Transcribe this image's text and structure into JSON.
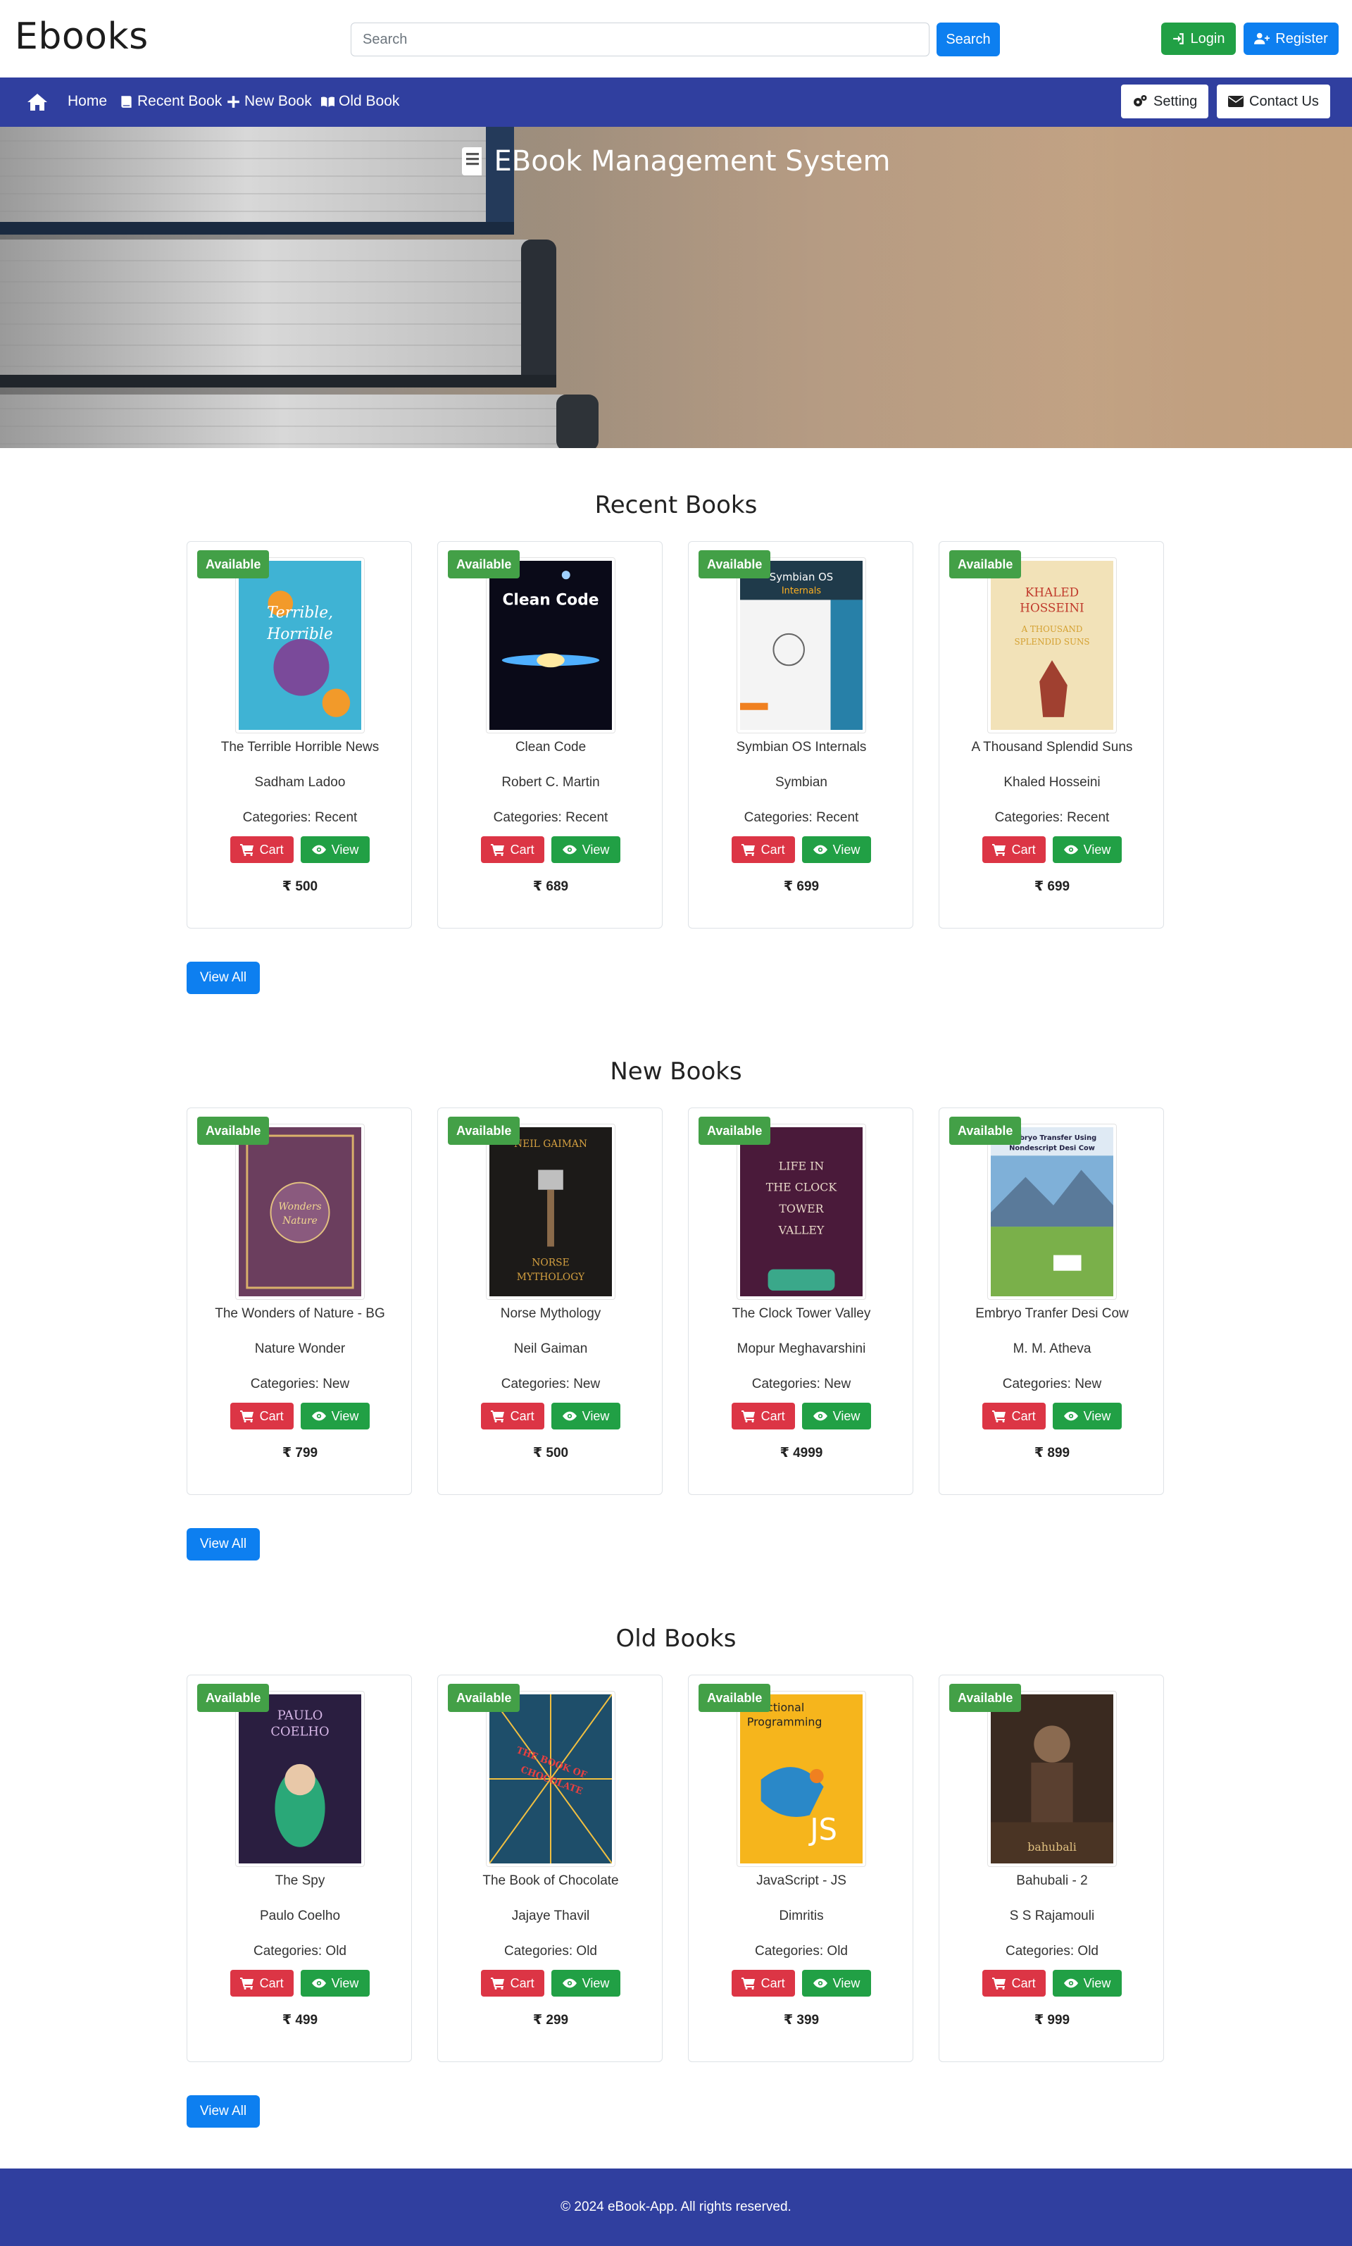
{
  "header": {
    "brand": "Ebooks",
    "search_placeholder": "Search",
    "search_button": "Search",
    "login_button": "Login",
    "register_button": "Register"
  },
  "nav": {
    "home": "Home",
    "recent_book": "Recent Book",
    "new_book": "New Book",
    "old_book": "Old Book",
    "setting": "Setting",
    "contact_us": "Contact Us"
  },
  "hero": {
    "title": "EBook Management System"
  },
  "sections": [
    {
      "title": "Recent Books",
      "view_all": "View All",
      "books": [
        {
          "badge": "Available",
          "title": "The Terrible Horrible News",
          "author": "Sadham Ladoo",
          "category": "Categories: Recent",
          "cart": "Cart",
          "view": "View",
          "price": "₹ 500",
          "cover_color": "#3fb3d4"
        },
        {
          "badge": "Available",
          "title": "Clean Code",
          "author": "Robert C. Martin",
          "category": "Categories: Recent",
          "cart": "Cart",
          "view": "View",
          "price": "₹ 689",
          "cover_color": "#0a0a18"
        },
        {
          "badge": "Available",
          "title": "Symbian OS Internals",
          "author": "Symbian",
          "category": "Categories: Recent",
          "cart": "Cart",
          "view": "View",
          "price": "₹ 699",
          "cover_color": "#1f3a4a"
        },
        {
          "badge": "Available",
          "title": "A Thousand Splendid Suns",
          "author": "Khaled Hosseini",
          "category": "Categories: Recent",
          "cart": "Cart",
          "view": "View",
          "price": "₹ 699",
          "cover_color": "#f2e2b8"
        }
      ]
    },
    {
      "title": "New Books",
      "view_all": "View All",
      "books": [
        {
          "badge": "Available",
          "title": "The Wonders of Nature - BG",
          "author": "Nature Wonder",
          "category": "Categories: New",
          "cart": "Cart",
          "view": "View",
          "price": "₹ 799",
          "cover_color": "#6b3e5e"
        },
        {
          "badge": "Available",
          "title": "Norse Mythology",
          "author": "Neil Gaiman",
          "category": "Categories: New",
          "cart": "Cart",
          "view": "View",
          "price": "₹ 500",
          "cover_color": "#1c1a18"
        },
        {
          "badge": "Available",
          "title": "The Clock Tower Valley",
          "author": "Mopur Meghavarshini",
          "category": "Categories: New",
          "cart": "Cart",
          "view": "View",
          "price": "₹ 4999",
          "cover_color": "#4a1a3a"
        },
        {
          "badge": "Available",
          "title": "Embryo Tranfer Desi Cow",
          "author": "M. M. Atheva",
          "category": "Categories: New",
          "cart": "Cart",
          "view": "View",
          "price": "₹ 899",
          "cover_color": "#7fb0d8"
        }
      ]
    },
    {
      "title": "Old Books",
      "view_all": "View All",
      "books": [
        {
          "badge": "Available",
          "title": "The Spy",
          "author": "Paulo Coelho",
          "category": "Categories: Old",
          "cart": "Cart",
          "view": "View",
          "price": "₹ 499",
          "cover_color": "#2a1e40"
        },
        {
          "badge": "Available",
          "title": "The Book of Chocolate",
          "author": "Jajaye Thavil",
          "category": "Categories: Old",
          "cart": "Cart",
          "view": "View",
          "price": "₹ 299",
          "cover_color": "#1e4e6a"
        },
        {
          "badge": "Available",
          "title": "JavaScript - JS",
          "author": "Dimritis",
          "category": "Categories: Old",
          "cart": "Cart",
          "view": "View",
          "price": "₹ 399",
          "cover_color": "#f6b51c"
        },
        {
          "badge": "Available",
          "title": "Bahubali - 2",
          "author": "S S Rajamouli",
          "category": "Categories: Old",
          "cart": "Cart",
          "view": "View",
          "price": "₹ 999",
          "cover_color": "#3a2a20"
        }
      ]
    }
  ],
  "footer": {
    "text": "© 2024 eBook-App. All rights reserved."
  },
  "colors": {
    "primary": "#0d7ff0",
    "success": "#21a045",
    "danger": "#dc3545",
    "nav": "#303f9f",
    "badge": "#43a047"
  }
}
